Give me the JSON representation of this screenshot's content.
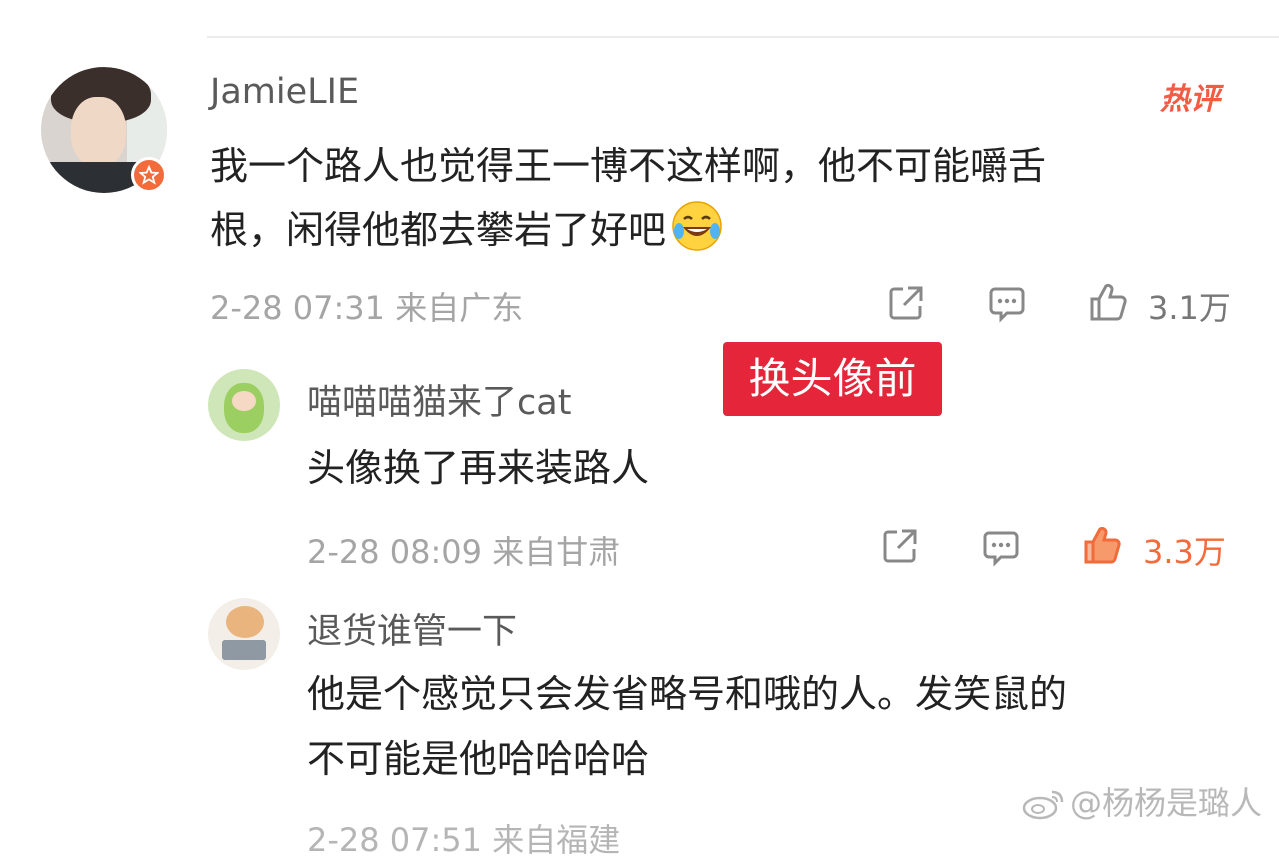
{
  "comments": [
    {
      "username": "JamieLIE",
      "hot_tag": "热评",
      "text_line1": "我一个路人也觉得王一博不这样啊，他不可能嚼舌",
      "text_line2": "根，闲得他都去攀岩了好吧",
      "emoji": "laughing-crying",
      "meta": "2-28 07:31 来自广东",
      "likes": "3.1万",
      "liked": false
    }
  ],
  "overlay_label": "换头像前",
  "replies": [
    {
      "username": "喵喵喵猫来了cat",
      "text": "头像换了再来装路人",
      "meta": "2-28 08:09 来自甘肃",
      "likes": "3.3万",
      "liked": true
    },
    {
      "username": "退货谁管一下",
      "text_line1": "他是个感觉只会发省略号和哦的人。发笑鼠的",
      "text_line2": "不可能是他哈哈哈哈",
      "meta_partial": "2-28 07:51 来自福建"
    }
  ],
  "watermark": "@杨杨是璐人",
  "colors": {
    "accent": "#f26b3a",
    "hot_tag": "#f25c45",
    "overlay_bg": "#e5263a",
    "meta_text": "#a5a5a5"
  },
  "icons": [
    "share-icon",
    "comment-icon",
    "like-icon",
    "laughing-crying-emoji",
    "weibo-logo-icon",
    "verified-badge-icon"
  ]
}
